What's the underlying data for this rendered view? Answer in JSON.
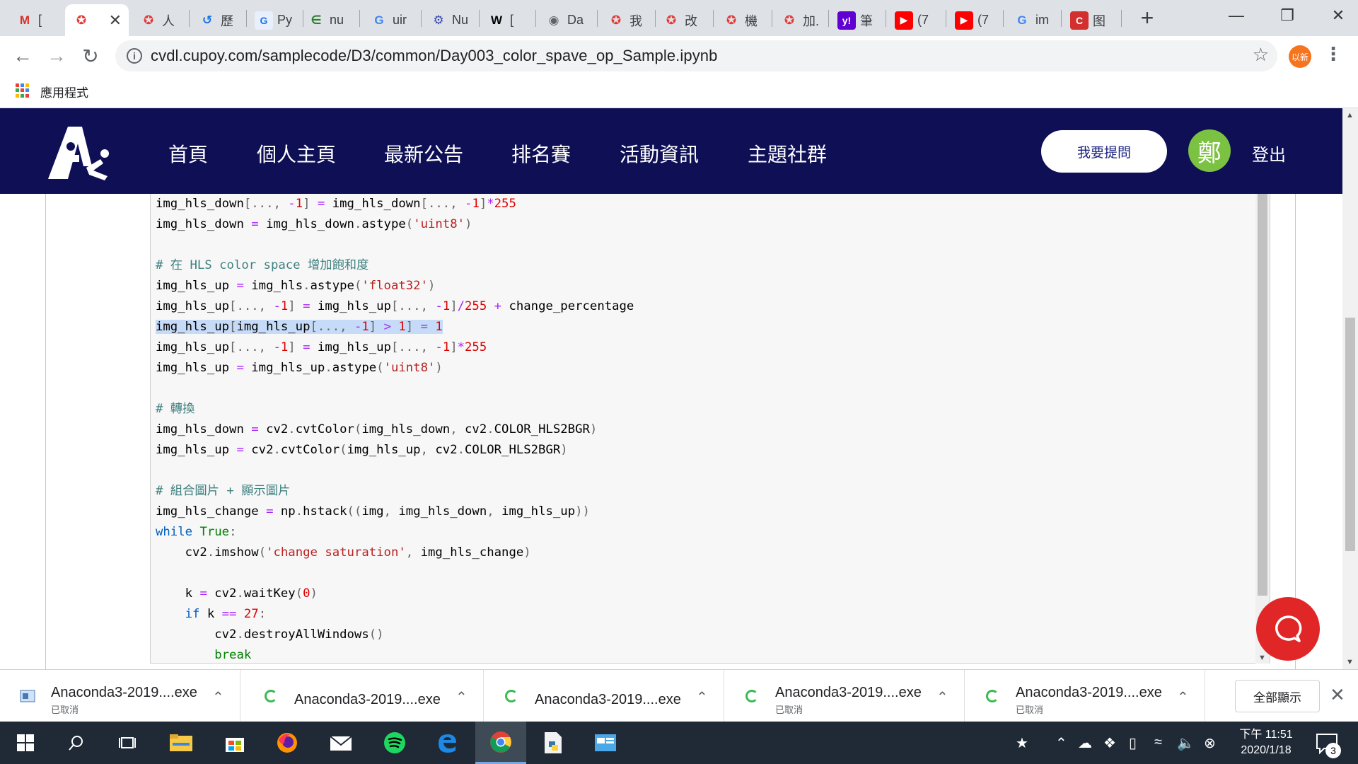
{
  "browser": {
    "tabs": [
      {
        "title": "[",
        "icon": "gmail-icon"
      },
      {
        "title": "",
        "icon": "cupoy-icon",
        "active": true
      },
      {
        "title": "人",
        "icon": "cupoy-icon"
      },
      {
        "title": "歷",
        "icon": "history-icon"
      },
      {
        "title": "Py",
        "icon": "g-square-icon"
      },
      {
        "title": "nu",
        "icon": "numpy-icon"
      },
      {
        "title": "uir",
        "icon": "google-icon"
      },
      {
        "title": "Nu",
        "icon": "gear-icon"
      },
      {
        "title": "[",
        "icon": "wikipedia-icon"
      },
      {
        "title": "Da",
        "icon": "globe-icon"
      },
      {
        "title": "我",
        "icon": "cupoy-icon"
      },
      {
        "title": "改",
        "icon": "cupoy-icon"
      },
      {
        "title": "機",
        "icon": "cupoy-icon"
      },
      {
        "title": "加.",
        "icon": "cupoy-icon"
      },
      {
        "title": "筆",
        "icon": "yahoo-icon"
      },
      {
        "title": "(7",
        "icon": "youtube-icon"
      },
      {
        "title": "(7",
        "icon": "youtube-icon"
      },
      {
        "title": "im",
        "icon": "google-icon"
      },
      {
        "title": "图",
        "icon": "c-red-icon"
      }
    ],
    "close_glyph": "✕",
    "new_tab_glyph": "+",
    "url": "cvdl.cupoy.com/samplecode/D3/common/Day003_color_spave_op_Sample.ipynb",
    "profile_initials": "以新",
    "bookmarks_label": "應用程式"
  },
  "site": {
    "nav": [
      "首頁",
      "個人主頁",
      "最新公告",
      "排名賽",
      "活動資訊",
      "主題社群"
    ],
    "ask_button": "我要提問",
    "avatar_initial": "鄭",
    "logout": "登出"
  },
  "code_lines": [
    "img_hls_down[..., -1] = img_hls_down[..., -1]*255",
    "img_hls_down = img_hls_down.astype('uint8')",
    "",
    "# 在 HLS color space 增加飽和度",
    "img_hls_up = img_hls.astype('float32')",
    "img_hls_up[..., -1] = img_hls_up[..., -1]/255 + change_percentage",
    "img_hls_up[img_hls_up[..., -1] > 1] = 1",
    "img_hls_up[..., -1] = img_hls_up[..., -1]*255",
    "img_hls_up = img_hls_up.astype('uint8')",
    "",
    "# 轉換",
    "img_hls_down = cv2.cvtColor(img_hls_down, cv2.COLOR_HLS2BGR)",
    "img_hls_up = cv2.cvtColor(img_hls_up, cv2.COLOR_HLS2BGR)",
    "",
    "# 組合圖片 + 顯示圖片",
    "img_hls_change = np.hstack((img, img_hls_down, img_hls_up))",
    "while True:",
    "    cv2.imshow('change saturation', img_hls_change)",
    "",
    "    k = cv2.waitKey(0)",
    "    if k == 27:",
    "        cv2.destroyAllWindows()",
    "        break"
  ],
  "highlighted_line": 6,
  "downloads": [
    {
      "name": "Anaconda3-2019....exe",
      "status": "已取消",
      "state": "cancelled"
    },
    {
      "name": "Anaconda3-2019....exe",
      "status": "",
      "state": "in-progress"
    },
    {
      "name": "Anaconda3-2019....exe",
      "status": "",
      "state": "in-progress"
    },
    {
      "name": "Anaconda3-2019....exe",
      "status": "已取消",
      "state": "cancelled"
    },
    {
      "name": "Anaconda3-2019....exe",
      "status": "已取消",
      "state": "cancelled"
    }
  ],
  "show_all": "全部顯示",
  "taskbar": {
    "time": "下午 11:51",
    "date": "2020/1/18",
    "notification_count": "3"
  },
  "colors": {
    "header_bg": "#0e0f55",
    "avatar_green": "#7cc242",
    "chat_red": "#e02626",
    "selection": "#c6dbf7"
  }
}
